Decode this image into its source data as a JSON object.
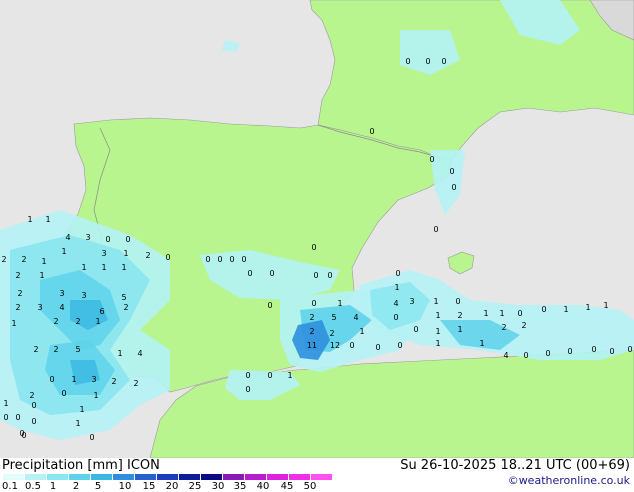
{
  "title": {
    "product": "Precipitation [mm]",
    "model": "ICON",
    "valid_time": "Su 26-10-2025 18..21 UTC (00+69)"
  },
  "credit": "©weatheronline.co.uk",
  "colors": {
    "ocean": "#e6e6e6",
    "land": "#b9f58f",
    "border": "#9a9a9a",
    "scale": [
      "#e2fcfc",
      "#b4f2f6",
      "#8ae6f0",
      "#5ed2ea",
      "#3ab8e2",
      "#2e8fde",
      "#2660cf",
      "#1c3cbe",
      "#0c1c9c",
      "#0a0a82",
      "#8a1ab4",
      "#b81ccc",
      "#dc22dc",
      "#f030e6",
      "#ff50f0"
    ]
  },
  "legend": {
    "ticks": [
      "0.1",
      "0.5",
      "1",
      "2",
      "5",
      "10",
      "15",
      "20",
      "25",
      "30",
      "35",
      "40",
      "45",
      "50"
    ]
  },
  "precip_values": [
    {
      "v": "1"
    },
    {
      "v": "1"
    },
    {
      "v": "4"
    },
    {
      "v": "3"
    },
    {
      "v": "0"
    },
    {
      "v": "0"
    },
    {
      "v": "2"
    },
    {
      "v": "2"
    },
    {
      "v": "1"
    },
    {
      "v": "1"
    },
    {
      "v": "3"
    },
    {
      "v": "1"
    },
    {
      "v": "2"
    },
    {
      "v": "0"
    },
    {
      "v": "2"
    },
    {
      "v": "1"
    },
    {
      "v": "1"
    },
    {
      "v": "1"
    },
    {
      "v": "1"
    },
    {
      "v": "2"
    },
    {
      "v": "3"
    },
    {
      "v": "3"
    },
    {
      "v": "5"
    },
    {
      "v": "2"
    },
    {
      "v": "3"
    },
    {
      "v": "4"
    },
    {
      "v": "6"
    },
    {
      "v": "2"
    },
    {
      "v": "1"
    },
    {
      "v": "2"
    },
    {
      "v": "2"
    },
    {
      "v": "1"
    },
    {
      "v": "2"
    },
    {
      "v": "2"
    },
    {
      "v": "5"
    },
    {
      "v": "1"
    },
    {
      "v": "4"
    },
    {
      "v": "0"
    },
    {
      "v": "1"
    },
    {
      "v": "3"
    },
    {
      "v": "2"
    },
    {
      "v": "2"
    },
    {
      "v": "2"
    },
    {
      "v": "0"
    },
    {
      "v": "1"
    },
    {
      "v": "1"
    },
    {
      "v": "0"
    },
    {
      "v": "1"
    },
    {
      "v": "0"
    },
    {
      "v": "0"
    },
    {
      "v": "1"
    },
    {
      "v": "0"
    },
    {
      "v": "0"
    },
    {
      "v": "0"
    },
    {
      "v": "0"
    },
    {
      "v": "0"
    },
    {
      "v": "0"
    },
    {
      "v": "1"
    },
    {
      "v": "2"
    },
    {
      "v": "5"
    },
    {
      "v": "4"
    },
    {
      "v": "2"
    },
    {
      "v": "11"
    },
    {
      "v": "12"
    },
    {
      "v": "1"
    },
    {
      "v": "2"
    },
    {
      "v": "1"
    },
    {
      "v": "4"
    },
    {
      "v": "3"
    },
    {
      "v": "1"
    },
    {
      "v": "0"
    },
    {
      "v": "0"
    },
    {
      "v": "1"
    },
    {
      "v": "2"
    },
    {
      "v": "1"
    },
    {
      "v": "0"
    },
    {
      "v": "1"
    },
    {
      "v": "0"
    },
    {
      "v": "1"
    },
    {
      "v": "1"
    },
    {
      "v": "1"
    },
    {
      "v": "0"
    },
    {
      "v": "1"
    },
    {
      "v": "1"
    },
    {
      "v": "2"
    },
    {
      "v": "2"
    },
    {
      "v": "0"
    },
    {
      "v": "0"
    },
    {
      "v": "0"
    },
    {
      "v": "1"
    },
    {
      "v": "1"
    },
    {
      "v": "4"
    },
    {
      "v": "0"
    },
    {
      "v": "0"
    },
    {
      "v": "0"
    },
    {
      "v": "0"
    },
    {
      "v": "0"
    },
    {
      "v": "0"
    },
    {
      "v": "0"
    },
    {
      "v": "0"
    },
    {
      "v": "0"
    },
    {
      "v": "0"
    },
    {
      "v": "0"
    },
    {
      "v": "0"
    },
    {
      "v": "0"
    },
    {
      "v": "0"
    },
    {
      "v": "0"
    },
    {
      "v": "0"
    },
    {
      "v": "0"
    },
    {
      "v": "0"
    },
    {
      "v": "1"
    },
    {
      "v": "0"
    },
    {
      "v": "0"
    },
    {
      "v": "0"
    },
    {
      "v": "0"
    },
    {
      "v": "0"
    },
    {
      "v": "0"
    },
    {
      "v": "0"
    },
    {
      "v": "0"
    },
    {
      "v": "0"
    },
    {
      "v": "0"
    }
  ]
}
